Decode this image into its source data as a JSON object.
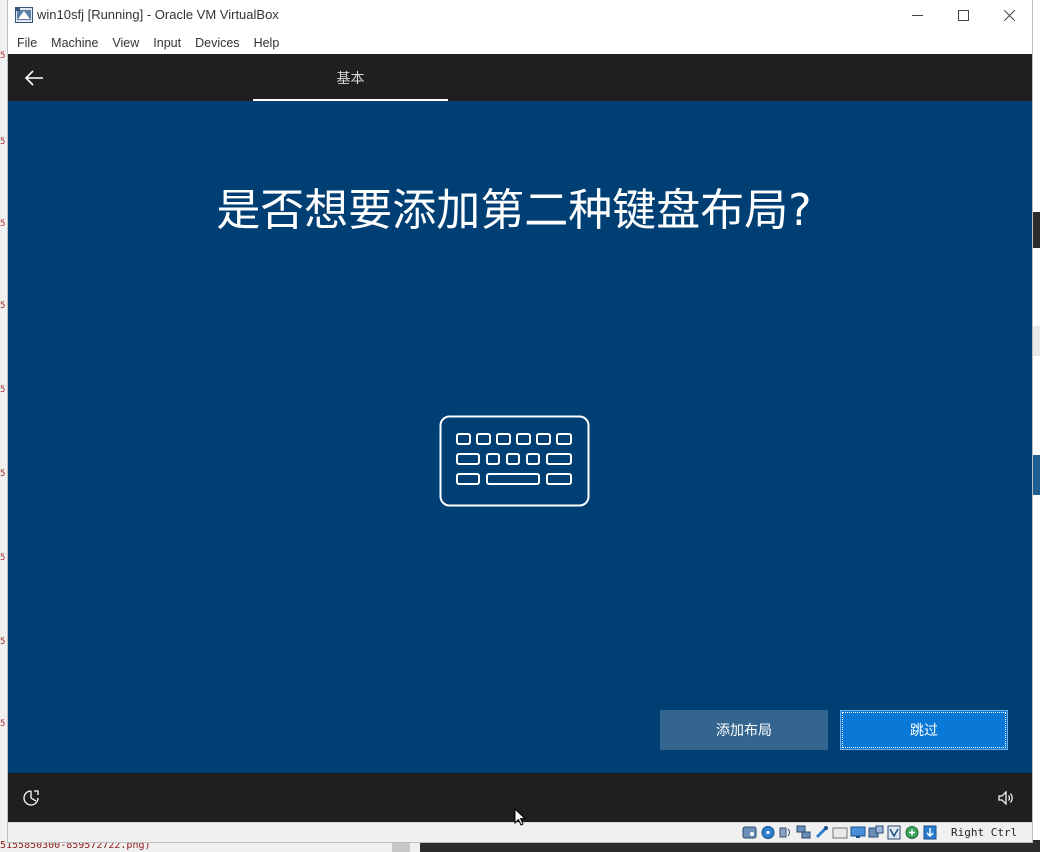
{
  "window": {
    "title": "win10sfj [Running] - Oracle VM VirtualBox",
    "minimize_label": "—",
    "maximize_label": "☐",
    "close_label": "✕"
  },
  "menu": {
    "items": [
      "File",
      "Machine",
      "View",
      "Input",
      "Devices",
      "Help"
    ]
  },
  "oobe": {
    "tab_label": "基本",
    "heading": "是否想要添加第二种键盘布局?",
    "add_button": "添加布局",
    "skip_button": "跳过",
    "icons": {
      "back": "arrow-left-icon",
      "keyboard": "keyboard-icon",
      "ease_of_access": "ease-of-access-icon",
      "volume": "volume-icon"
    }
  },
  "statusbar": {
    "host_key": "Right Ctrl"
  },
  "background": {
    "bottom_text": "5155850300-859572722.png)"
  },
  "colors": {
    "guest_bg": "#003f74",
    "oobe_bar": "#1f1f1f",
    "primary_button": "#0a78d6",
    "secondary_button": "#33658f"
  }
}
